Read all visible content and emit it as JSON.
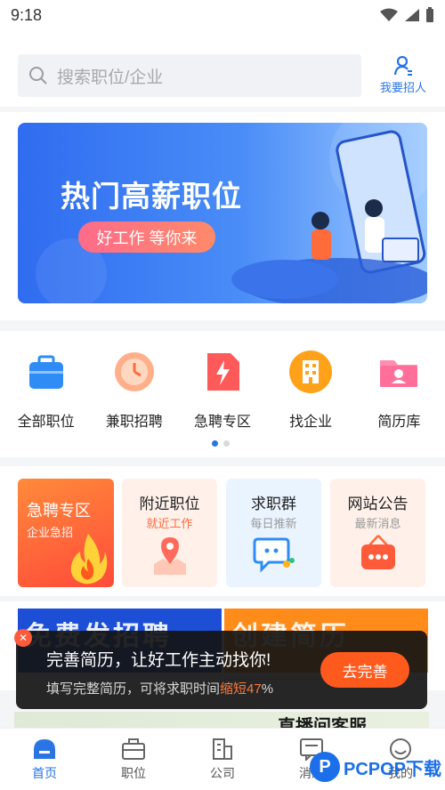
{
  "status_bar": {
    "time": "9:18"
  },
  "search": {
    "placeholder": "搜索职位/企业"
  },
  "recruit": {
    "label": "我要招人"
  },
  "banner": {
    "title": "热门高薪职位",
    "pill": "好工作 等你来"
  },
  "categories": [
    {
      "label": "全部职位",
      "icon": "briefcase-icon",
      "color": "#2f8cf5"
    },
    {
      "label": "兼职招聘",
      "icon": "clock-icon",
      "color": "#ff8a5a"
    },
    {
      "label": "急聘专区",
      "icon": "lightning-doc-icon",
      "color": "#ff5a5a"
    },
    {
      "label": "找企业",
      "icon": "building-icon",
      "color": "#ffa21a"
    },
    {
      "label": "简历库",
      "icon": "folder-user-icon",
      "color": "#ff6f9a"
    }
  ],
  "cards": {
    "urgent": {
      "title": "急聘专区",
      "sub": "企业急招"
    },
    "nearby": {
      "title": "附近职位",
      "sub": "就近工作",
      "sub_color": "#ff6a3a"
    },
    "group": {
      "title": "求职群",
      "sub": "每日推新",
      "sub_color": "#999999"
    },
    "notice": {
      "title": "网站公告",
      "sub": "最新消息",
      "sub_color": "#999999"
    }
  },
  "promos": {
    "left": "免费发招聘",
    "right": "创建简历"
  },
  "toast": {
    "title": "完善简历，让好工作主动找你!",
    "desc_prefix": "填写完整简历，可将求职时间",
    "desc_highlight": "缩短47",
    "desc_suffix": "%",
    "button": "去完善",
    "close": "✕"
  },
  "live_banner": {
    "text": "直播间客服"
  },
  "tabbar": [
    {
      "label": "首页",
      "icon": "home-icon",
      "active": true
    },
    {
      "label": "职位",
      "icon": "briefcase-icon",
      "active": false
    },
    {
      "label": "公司",
      "icon": "building-icon",
      "active": false
    },
    {
      "label": "消息",
      "icon": "message-icon",
      "active": false
    },
    {
      "label": "我的",
      "icon": "smiley-icon",
      "active": false
    }
  ],
  "watermark": {
    "logo": "P",
    "text": "PCPOP下载"
  },
  "colors": {
    "accent": "#2a74e6",
    "orange": "#ff5a1e"
  }
}
